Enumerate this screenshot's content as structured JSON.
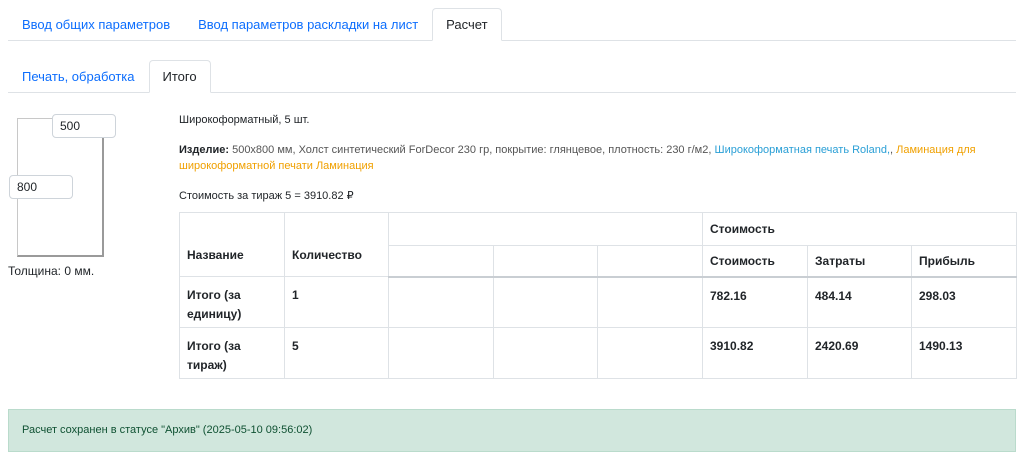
{
  "main_tabs": [
    {
      "label": "Ввод общих параметров",
      "active": false
    },
    {
      "label": "Ввод параметров раскладки на лист",
      "active": false
    },
    {
      "label": "Расчет",
      "active": true
    }
  ],
  "sub_tabs": [
    {
      "label": "Печать, обработка",
      "active": false
    },
    {
      "label": "Итого",
      "active": true
    }
  ],
  "diagram": {
    "width_value": "500",
    "height_value": "800",
    "thickness_label": "Толщина: 0 мм."
  },
  "info": {
    "title": "Широкоформатный, 5 шт.",
    "product_label": "Изделие:",
    "product_size": "500x800 мм",
    "product_material": ", Холст синтетический ForDecor 230 гр, покрытие: глянцевое, плотность: 230 г/м2,",
    "product_link_print": "Широкоформатная печать Roland,",
    "product_separator": ",",
    "product_link_lamination": "Ламинация для широкоформатной печати Ламинация",
    "cost_line": "Стоимость за тираж 5 = 3910.82 ₽"
  },
  "table": {
    "headers": {
      "name": "Название",
      "quantity": "Количество",
      "cost_group": "Стоимость",
      "cost": "Стоимость",
      "expenses": "Затраты",
      "profit": "Прибыль"
    },
    "rows": [
      {
        "name": "Итого (за единицу)",
        "quantity": "1",
        "cost": "782.16",
        "expenses": "484.14",
        "profit": "298.03"
      },
      {
        "name": "Итого (за тираж)",
        "quantity": "5",
        "cost": "3910.82",
        "expenses": "2420.69",
        "profit": "1490.13"
      }
    ]
  },
  "alert": {
    "text": "Расчет сохранен в статусе \"Архив\" (2025-05-10 09:56:02)"
  },
  "colors": {
    "link": "#0d6efd",
    "link_blue": "#2a9fd6",
    "link_orange": "#f0a000",
    "alert_bg": "#d1e7dd",
    "alert_text": "#0f5132"
  }
}
